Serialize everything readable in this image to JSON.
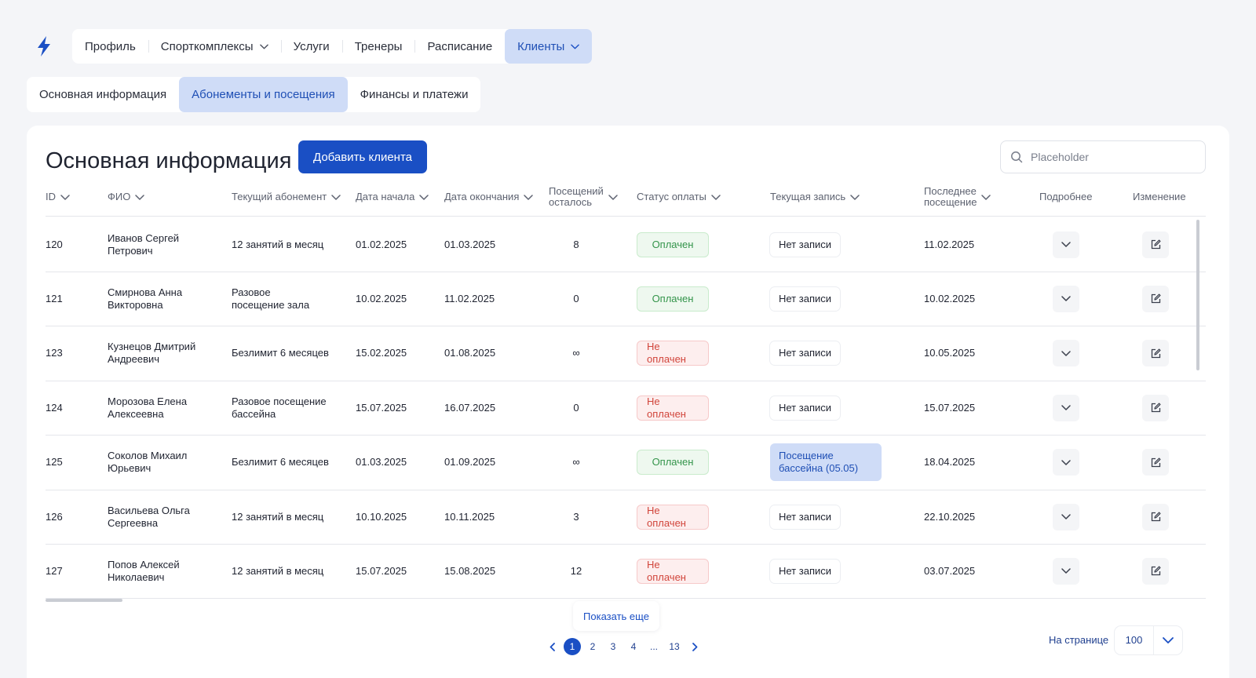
{
  "colors": {
    "accent": "#1a4fc4",
    "active_tab_bg": "#cfdcf7",
    "paid": "#33944a",
    "unpaid": "#d1453b"
  },
  "logo_icon": "lightning-icon",
  "topnav": [
    {
      "label": "Профиль",
      "dropdown": false,
      "active": false
    },
    {
      "label": "Спорткомплексы",
      "dropdown": true,
      "active": false
    },
    {
      "label": "Услуги",
      "dropdown": false,
      "active": false
    },
    {
      "label": "Тренеры",
      "dropdown": false,
      "active": false
    },
    {
      "label": "Расписание",
      "dropdown": false,
      "active": false
    },
    {
      "label": "Клиенты",
      "dropdown": true,
      "active": true
    }
  ],
  "subtabs": [
    {
      "label": "Основная информация",
      "active": false
    },
    {
      "label": "Абонементы и посещения",
      "active": true
    },
    {
      "label": "Финансы и платежи",
      "active": false
    }
  ],
  "main": {
    "title": "Основная информация",
    "add_button": "Добавить клиента",
    "search_placeholder": "Placeholder"
  },
  "table": {
    "columns": [
      {
        "key": "id",
        "label": "ID",
        "sortable": true
      },
      {
        "key": "name",
        "label": "ФИО",
        "sortable": true
      },
      {
        "key": "sub",
        "label": "Текущий абонемент",
        "sortable": true
      },
      {
        "key": "start",
        "label": "Дата начала",
        "sortable": true
      },
      {
        "key": "end",
        "label": "Дата окончания",
        "sortable": true
      },
      {
        "key": "left",
        "label": "Посещений\nосталось",
        "sortable": true
      },
      {
        "key": "status",
        "label": "Статус оплаты",
        "sortable": true
      },
      {
        "key": "record",
        "label": "Текущая запись",
        "sortable": true
      },
      {
        "key": "last",
        "label": "Последнее\nпосещение",
        "sortable": true
      },
      {
        "key": "details",
        "label": "Подробнее",
        "sortable": false
      },
      {
        "key": "edit",
        "label": "Изменение",
        "sortable": false
      }
    ],
    "rows": [
      {
        "id": "120",
        "name": "Иванов Сергей\nПетрович",
        "sub": "12 занятий в месяц",
        "start": "01.02.2025",
        "end": "01.03.2025",
        "left": "8",
        "status": "Оплачен",
        "paid": true,
        "record": "Нет записи",
        "record_active": false,
        "last": "11.02.2025"
      },
      {
        "id": "121",
        "name": "Смирнова Анна\nВикторовна",
        "sub": "Разовое\nпосещение зала",
        "start": "10.02.2025",
        "end": "11.02.2025",
        "left": "0",
        "status": "Оплачен",
        "paid": true,
        "record": "Нет записи",
        "record_active": false,
        "last": "10.02.2025"
      },
      {
        "id": "123",
        "name": "Кузнецов Дмитрий\nАндреевич",
        "sub": "Безлимит 6 месяцев",
        "start": "15.02.2025",
        "end": "01.08.2025",
        "left": "∞",
        "status": "Не оплачен",
        "paid": false,
        "record": "Нет записи",
        "record_active": false,
        "last": "10.05.2025"
      },
      {
        "id": "124",
        "name": "Морозова Елена\nАлексеевна",
        "sub": "Разовое посещение\nбассейна",
        "start": "15.07.2025",
        "end": "16.07.2025",
        "left": "0",
        "status": "Не оплачен",
        "paid": false,
        "record": "Нет записи",
        "record_active": false,
        "last": "15.07.2025"
      },
      {
        "id": "125",
        "name": "Соколов Михаил\nЮрьевич",
        "sub": "Безлимит 6 месяцев",
        "start": "01.03.2025",
        "end": "01.09.2025",
        "left": "∞",
        "status": "Оплачен",
        "paid": true,
        "record": "Посещение\nбассейна (05.05)",
        "record_active": true,
        "last": "18.04.2025"
      },
      {
        "id": "126",
        "name": "Васильева Ольга\nСергеевна",
        "sub": "12 занятий в месяц",
        "start": "10.10.2025",
        "end": "10.11.2025",
        "left": "3",
        "status": "Не оплачен",
        "paid": false,
        "record": "Нет записи",
        "record_active": false,
        "last": "22.10.2025"
      },
      {
        "id": "127",
        "name": "Попов Алексей\nНиколаевич",
        "sub": "12 занятий в месяц",
        "start": "15.07.2025",
        "end": "15.08.2025",
        "left": "12",
        "status": "Не оплачен",
        "paid": false,
        "record": "Нет записи",
        "record_active": false,
        "last": "03.07.2025"
      }
    ]
  },
  "show_more": "Показать еще",
  "pagination": {
    "pages": [
      "1",
      "2",
      "3",
      "4",
      "...",
      "13"
    ],
    "current": "1"
  },
  "per_page": {
    "label": "На странице",
    "value": "100"
  }
}
